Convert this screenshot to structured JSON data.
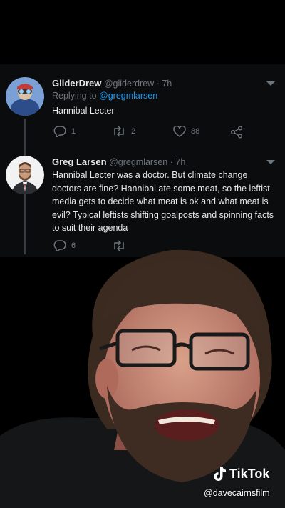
{
  "tweets": [
    {
      "name": "GliderDrew",
      "handle": "@gliderdrew",
      "time": "· 7h",
      "replying_prefix": "Replying to ",
      "replying_handle": "@gregmlarsen",
      "text": "Hannibal Lecter",
      "replies": "1",
      "retweets": "2",
      "likes": "88"
    },
    {
      "name": "Greg Larsen",
      "handle": "@gregmlarsen",
      "time": "· 7h",
      "text": "Hannibal Lecter was a doctor. But climate change doctors are fine? Hannibal ate some meat, so the leftist media gets to decide what meat is ok and what meat is evil? Typical leftists shifting goalposts and spinning facts to suit their agenda",
      "replies": "6"
    }
  ],
  "watermark": {
    "brand": "TikTok",
    "username": "@davecairnsfilm"
  },
  "colors": {
    "background": "#000000",
    "link": "#1d9bf0",
    "muted": "#6e767d",
    "text": "#e7e9ea"
  }
}
